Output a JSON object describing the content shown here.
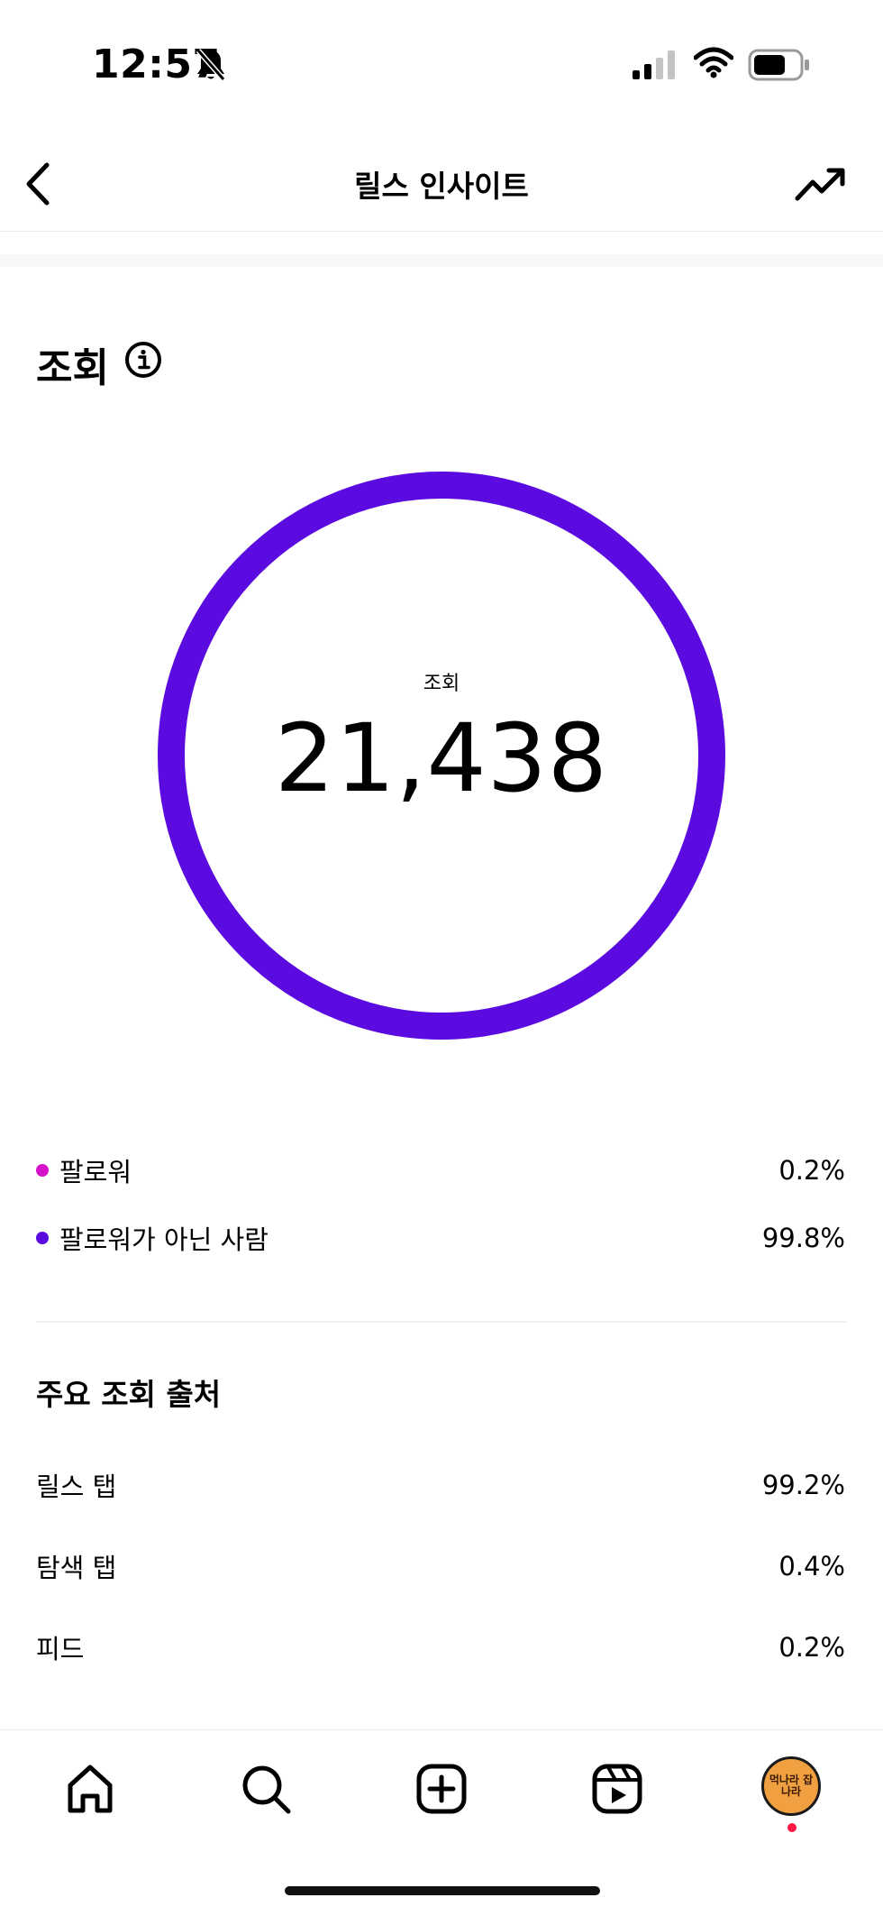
{
  "status_bar": {
    "time": "12:57",
    "icons": [
      "bell-slash-icon",
      "signal-icon",
      "wifi-icon",
      "battery-icon"
    ]
  },
  "header": {
    "title": "릴스 인사이트",
    "back_icon": "chevron-left-icon",
    "trend_icon": "trending-up-icon"
  },
  "views": {
    "section_title": "조회",
    "info_icon": "info-icon",
    "ring_label": "조회",
    "total": "21,438",
    "ring_color": "#5b0be0",
    "breakdown": [
      {
        "label": "팔로워",
        "value": "0.2%",
        "color": "#d511c9"
      },
      {
        "label": "팔로워가 아닌 사람",
        "value": "99.8%",
        "color": "#5b0be0"
      }
    ]
  },
  "top_sources": {
    "title": "주요 조회 출처",
    "rows": [
      {
        "label": "릴스 탭",
        "value": "99.2%"
      },
      {
        "label": "탐색 탭",
        "value": "0.4%"
      },
      {
        "label": "피드",
        "value": "0.2%"
      }
    ]
  },
  "bottom_nav": {
    "items": [
      "home-icon",
      "search-icon",
      "create-icon",
      "reels-icon",
      "profile-avatar"
    ],
    "avatar_text": "먹나라 잡나라"
  }
}
